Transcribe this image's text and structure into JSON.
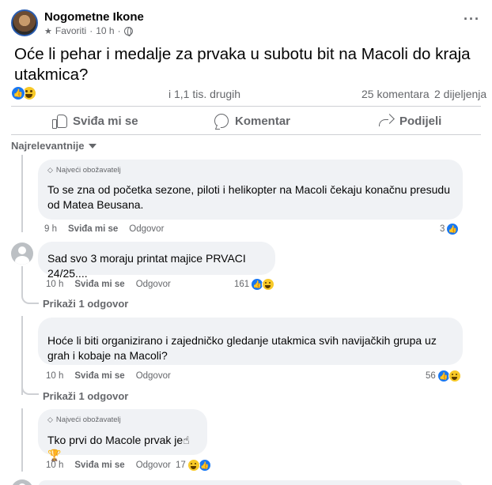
{
  "post": {
    "page_name": "Nogometne Ikone",
    "audience": "Favoriti",
    "time": "10 h",
    "dot": "·",
    "more": "···",
    "text": "Oće li pehar i medalje za prvaka u subotu bit na Macoli do kraja utakmica?",
    "reactions_text": "i 1,1 tis. drugih",
    "comments_count": "25 komentara",
    "shares_count": "2 dijeljenja",
    "actions": {
      "like": "Sviđa mi se",
      "comment": "Komentar",
      "share": "Podijeli"
    },
    "sort_label": "Najrelevantnije"
  },
  "comments": [
    {
      "badge": "Najveći obožavatelj",
      "text": "To se zna od početka sezone, piloti i helikopter na Macoli čekaju konačnu presudu od Matea Beusana.",
      "time": "9 h",
      "like": "Sviđa mi se",
      "reply": "Odgovor",
      "reaction_count": "3"
    },
    {
      "badge": "",
      "text": "Sad svo 3 moraju printat majice PRVACI 24/25....",
      "time": "10 h",
      "like": "Sviđa mi se",
      "reply": "Odgovor",
      "reaction_count": "161",
      "show_replies": "Prikaži 1 odgovor"
    },
    {
      "badge": "",
      "text": "Hoće li biti organizirano i zajedničko gledanje utakmica svih navijačkih grupa uz grah i kobaje na Macoli?",
      "time": "10 h",
      "like": "Sviđa mi se",
      "reply": "Odgovor",
      "reaction_count": "56",
      "show_replies": "Prikaži 1 odgovor"
    },
    {
      "badge": "Najveći obožavatelj",
      "text": "Tko prvi do Macole prvak je☝🏆",
      "time": "10 h",
      "like": "Sviđa mi se",
      "reply": "Odgovor",
      "reaction_count": "17"
    }
  ],
  "icons": {
    "page_avatar": "page-avatar",
    "audience": "star-icon",
    "privacy": "globe-icon",
    "like_reaction": "like-reaction-icon",
    "haha_reaction": "haha-reaction-icon",
    "badge": "diamond-icon"
  },
  "colors": {
    "accent": "#1877f2",
    "muted": "#65676b",
    "bubble": "#f0f2f5",
    "divider": "#ced0d4"
  }
}
